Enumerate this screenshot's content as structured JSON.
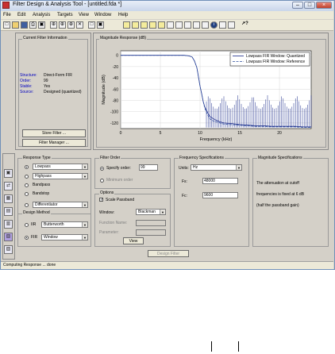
{
  "window": {
    "title": "Filter Design & Analysis Tool - [untitled.fda *]"
  },
  "menubar": [
    "File",
    "Edit",
    "Analysis",
    "Targets",
    "View",
    "Window",
    "Help"
  ],
  "toolbar": {
    "icons": [
      "new-icon",
      "open-icon",
      "save-icon",
      "print-icon",
      "print-preview-icon",
      "zoom-in-icon",
      "zoom-x-icon",
      "zoom-y-icon",
      "full-view-icon",
      "new-figure-icon",
      "magnitude-response-icon",
      "phase-response-icon",
      "mag-phase-icon",
      "group-delay-icon",
      "phase-delay-icon",
      "impulse-response-icon",
      "step-response-icon",
      "pole-zero-icon",
      "filter-coefficients-icon",
      "filter-info-icon",
      "magnitude-estimate-icon",
      "noise-power-icon",
      "whats-this-icon"
    ]
  },
  "current_filter": {
    "title": "Current Filter Information",
    "rows": [
      {
        "key": "Structure:",
        "value": "Direct-Form FIR"
      },
      {
        "key": "Order:",
        "value": "99"
      },
      {
        "key": "Stable:",
        "value": "Yes"
      },
      {
        "key": "Source:",
        "value": "Designed (quantized)"
      }
    ],
    "store_button": "Store Filter ...",
    "manager_button": "Filter Manager ..."
  },
  "magnitude_panel": {
    "title": "Magnitude Response (dB)",
    "legend": [
      "Lowpass FIR Window: Quantized",
      "Lowpass FIR Window: Reference"
    ]
  },
  "chart_data": {
    "type": "line",
    "xlabel": "Frequency (kHz)",
    "ylabel": "Magnitude (dB)",
    "xlim": [
      0,
      24
    ],
    "ylim": [
      -130,
      8
    ],
    "xticks": [
      "0",
      "5",
      "10",
      "15",
      "20"
    ],
    "yticks": [
      "0",
      "-20",
      "-40",
      "-60",
      "-80",
      "-100",
      "-120"
    ],
    "grid": true,
    "legend_position": "top-right",
    "series": [
      {
        "name": "Lowpass FIR Window: Quantized",
        "x": [
          0,
          2,
          4,
          6,
          7,
          8,
          8.6,
          9.0,
          9.3,
          9.6,
          9.8,
          10.0,
          10.2,
          10.4,
          10.6,
          10.9,
          11.2,
          11.6,
          12.0,
          12.5,
          13,
          14,
          15,
          16,
          17,
          18,
          19,
          20,
          21,
          22,
          23,
          24
        ],
        "y": [
          0,
          0,
          0,
          0,
          0,
          0,
          -1,
          -3,
          -10,
          -22,
          -38,
          -55,
          -68,
          -82,
          -92,
          -100,
          -108,
          -112,
          -115,
          -118,
          -120,
          -121,
          -123,
          -124,
          -125,
          -125,
          -126,
          -126,
          -126,
          -126,
          -127,
          -127
        ]
      },
      {
        "name": "Lowpass FIR Window: Reference",
        "x": [
          0,
          2,
          4,
          6,
          7,
          8,
          8.6,
          9.0,
          9.3,
          9.6,
          9.8,
          10.0,
          10.2,
          10.4,
          10.6,
          10.9,
          11.2,
          11.6,
          12.0,
          12.5,
          13,
          14,
          15,
          16,
          17,
          18,
          19,
          20,
          21,
          22,
          23,
          24
        ],
        "y": [
          0,
          0,
          0,
          0,
          0,
          0,
          -1,
          -3,
          -10,
          -22,
          -38,
          -55,
          -68,
          -82,
          -94,
          -104,
          -112,
          -116,
          -118,
          -120,
          -122,
          -123,
          -124,
          -125,
          -126,
          -126,
          -127,
          -127,
          -127,
          -127,
          -128,
          -128
        ]
      }
    ]
  },
  "response_type": {
    "title": "Response Type",
    "options": [
      {
        "label": "Lowpass",
        "selected": true,
        "dropdown": true
      },
      {
        "label": "Highpass",
        "selected": false,
        "dropdown": true
      },
      {
        "label": "Bandpass",
        "selected": false,
        "dropdown": false
      },
      {
        "label": "Bandstop",
        "selected": false,
        "dropdown": false
      },
      {
        "label": "Differentiator",
        "selected": false,
        "dropdown": true
      }
    ]
  },
  "design_method": {
    "title": "Design Method",
    "iir_label": "IIR",
    "iir_value": "Butterworth",
    "fir_label": "FIR",
    "fir_value": "Window"
  },
  "filter_order": {
    "title": "Filter Order",
    "specify_label": "Specify order:",
    "specify_value": "99",
    "minimum_label": "Minimum order"
  },
  "options": {
    "title": "Options",
    "scale_label": "Scale Passband",
    "window_label": "Window:",
    "window_value": "Blackman",
    "function_label": "Function Name:",
    "parameter_label": "Parameter:",
    "view_button": "View"
  },
  "freq_spec": {
    "title": "Frequency Specifications",
    "units_label": "Units:",
    "units_value": "Hz",
    "fs_label": "Fs:",
    "fs_value": "48000",
    "fc_label": "Fc:",
    "fc_value": "9600"
  },
  "mag_spec": {
    "title": "Magnitude Specifications",
    "line1": "The attenuation at cutoff",
    "line2": "frequencies is fixed at 6 dB",
    "line3": "(half the passband gain)"
  },
  "design_button": "Design Filter",
  "sidebar_icons": [
    "pole-zero-editor-icon",
    "transform-filter-icon",
    "realize-model-icon",
    "import-filter-icon",
    "convert-structure-icon",
    "set-quantization-icon",
    "multirate-icon",
    "design-filter-icon"
  ],
  "status": "Computing Response ... done"
}
